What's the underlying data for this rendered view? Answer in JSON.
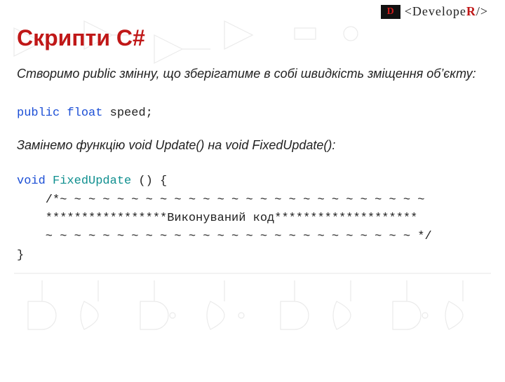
{
  "brand": {
    "badge": "D",
    "name_plain": "Develope",
    "name_accent": "R"
  },
  "title": "Скрипти С#",
  "intro": "Створимо public змінну, що зберігатиме в собі швидкість зміщення об’єкту:",
  "snippet1": {
    "kw_public": "public",
    "kw_float": "float",
    "rest": " speed;"
  },
  "caption": "Замінемо функцію void Update() на void FixedUpdate():",
  "snippet2": {
    "kw_void": "void",
    "kw_name": "FixedUpdate",
    "line0_tail": " () {",
    "line1": "    /*~ ~ ~ ~ ~ ~ ~ ~ ~ ~ ~ ~ ~ ~ ~ ~ ~ ~ ~ ~ ~ ~ ~ ~ ~ ~",
    "line2": "    *****************Виконуваний код********************",
    "line3": "    ~ ~ ~ ~ ~ ~ ~ ~ ~ ~ ~ ~ ~ ~ ~ ~ ~ ~ ~ ~ ~ ~ ~ ~ ~ ~ */",
    "line4": "}"
  }
}
